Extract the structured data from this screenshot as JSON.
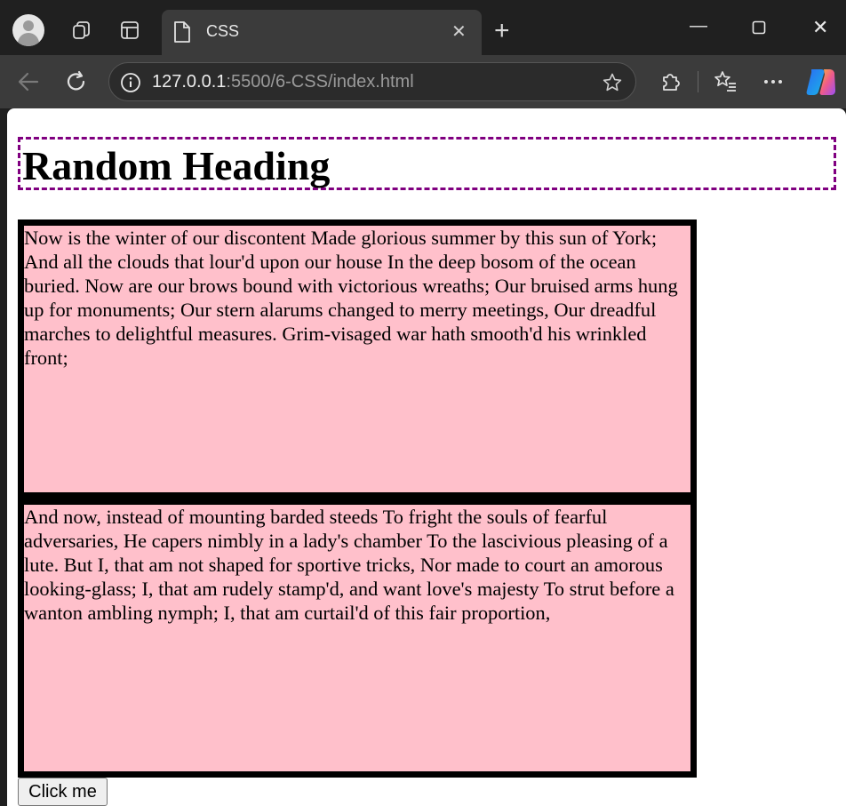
{
  "browser": {
    "tab_title": "CSS",
    "url_host": "127.0.0.1",
    "url_path": ":5500/6-CSS/index.html"
  },
  "page": {
    "heading": "Random Heading",
    "paragraphs": [
      "Now is the winter of our discontent Made glorious summer by this sun of York; And all the clouds that lour'd upon our house In the deep bosom of the ocean buried. Now are our brows bound with victorious wreaths; Our bruised arms hung up for monuments; Our stern alarums changed to merry meetings, Our dreadful marches to delightful measures. Grim-visaged war hath smooth'd his wrinkled front;",
      "And now, instead of mounting barded steeds To fright the souls of fearful adversaries, He capers nimbly in a lady's chamber To the lascivious pleasing of a lute. But I, that am not shaped for sportive tricks, Nor made to court an amorous looking-glass; I, that am rudely stamp'd, and want love's majesty To strut before a wanton ambling nymph; I, that am curtail'd of this fair proportion,"
    ],
    "button_label": "Click me"
  },
  "colors": {
    "heading_border": "#800080",
    "paragraph_bg": "#ffc0cb",
    "paragraph_border": "#000000"
  },
  "icons": {
    "tabstrip": [
      "profile-avatar-icon",
      "workspaces-icon",
      "vertical-tabs-icon",
      "document-icon",
      "close-icon",
      "new-tab-icon",
      "minimize-icon",
      "maximize-icon",
      "window-close-icon"
    ],
    "toolbar": [
      "back-icon",
      "refresh-icon",
      "site-info-icon",
      "favorite-star-icon",
      "extensions-icon",
      "favorites-icon",
      "more-icon",
      "copilot-icon"
    ]
  }
}
